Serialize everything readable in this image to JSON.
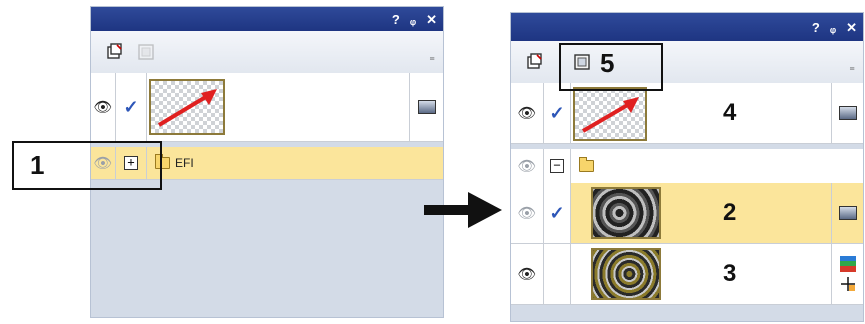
{
  "left_panel": {
    "titlebar_buttons": [
      "?",
      "ᵩ",
      "✕"
    ],
    "overflow_glyph": "⁼",
    "group_label": "EFI"
  },
  "right_panel": {
    "titlebar_buttons": [
      "?",
      "ᵩ",
      "✕"
    ],
    "overflow_glyph": "⁼"
  },
  "annotations": {
    "callout_1": "1",
    "callout_2": "2",
    "callout_3": "3",
    "callout_4": "4",
    "callout_5": "5"
  },
  "icons": {
    "eye": "👁",
    "check": "✓",
    "plus": "+",
    "minus": "−",
    "arrow": "→"
  },
  "colors": {
    "titlebar": "#1e3582",
    "selected_row": "#fbe59b",
    "panel_bg": "#d3dbe7",
    "check": "#2d56b8"
  }
}
